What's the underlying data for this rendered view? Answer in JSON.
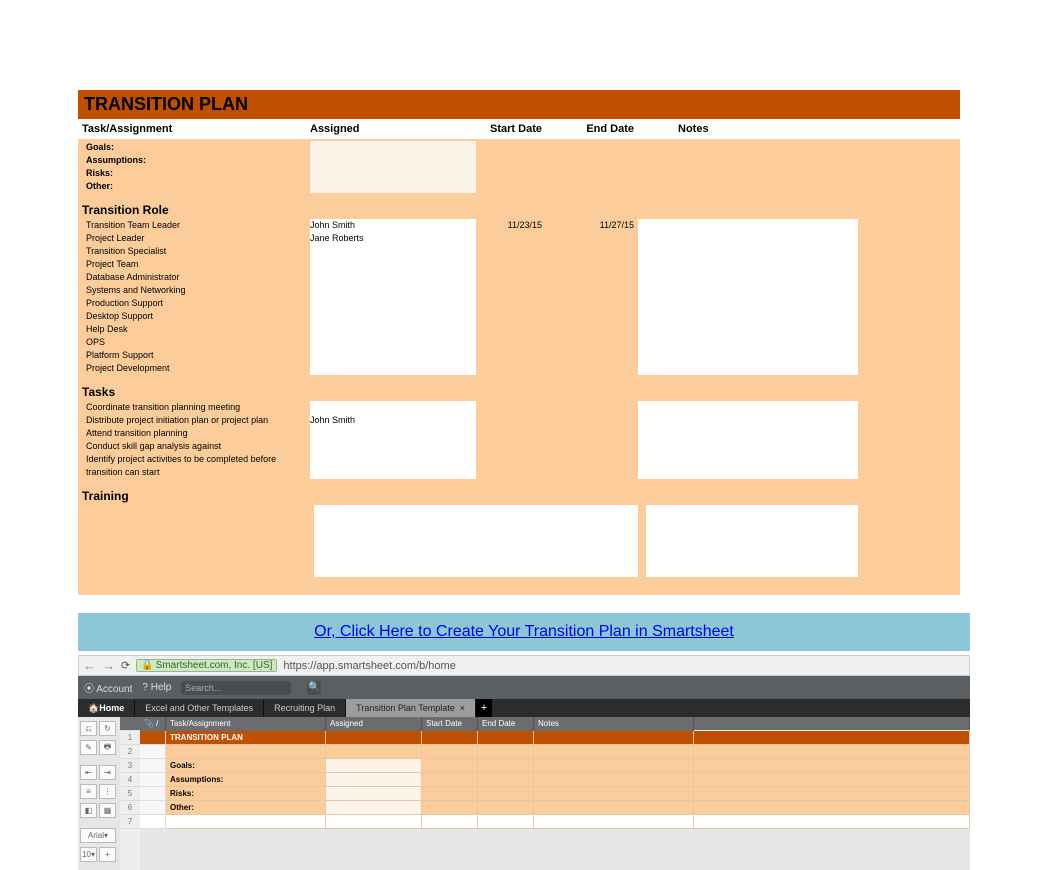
{
  "title": "TRANSITION PLAN",
  "columns": {
    "task": "Task/Assignment",
    "assigned": "Assigned",
    "start": "Start Date",
    "end": "End Date",
    "notes": "Notes"
  },
  "labels": {
    "goals": "Goals:",
    "assumptions": "Assumptions:",
    "risks": "Risks:",
    "other": "Other:",
    "transition_role": "Transition Role",
    "tasks": "Tasks",
    "training": "Training"
  },
  "roles": [
    {
      "name": "Transition Team Leader",
      "assigned": "John Smith",
      "start": "11/23/15",
      "end": "11/27/15"
    },
    {
      "name": "Project Leader",
      "assigned": "Jane Roberts",
      "start": "",
      "end": ""
    },
    {
      "name": "Transition Specialist",
      "assigned": "",
      "start": "",
      "end": ""
    },
    {
      "name": "Project Team",
      "assigned": "",
      "start": "",
      "end": ""
    },
    {
      "name": "Database Administrator",
      "assigned": "",
      "start": "",
      "end": ""
    },
    {
      "name": "Systems and Networking",
      "assigned": "",
      "start": "",
      "end": ""
    },
    {
      "name": "Production Support",
      "assigned": "",
      "start": "",
      "end": ""
    },
    {
      "name": "Desktop Support",
      "assigned": "",
      "start": "",
      "end": ""
    },
    {
      "name": "Help Desk",
      "assigned": "",
      "start": "",
      "end": ""
    },
    {
      "name": "OPS",
      "assigned": "",
      "start": "",
      "end": ""
    },
    {
      "name": "Platform Support",
      "assigned": "",
      "start": "",
      "end": ""
    },
    {
      "name": "Project Development",
      "assigned": "",
      "start": "",
      "end": ""
    }
  ],
  "tasks": [
    {
      "name": "Coordinate transition planning meeting",
      "assigned": ""
    },
    {
      "name": "Distribute project initiation plan or project plan",
      "assigned": "John Smith"
    },
    {
      "name": "Attend transition planning",
      "assigned": ""
    },
    {
      "name": "Conduct skill gap analysis against",
      "assigned": ""
    },
    {
      "name": "Identify project activities to be completed before transition can start",
      "assigned": ""
    }
  ],
  "cta": "Or, Click Here to Create Your Transition Plan in Smartsheet",
  "browser": {
    "cert": "Smartsheet.com, Inc. [US]",
    "url": "https://app.smartsheet.com/b/home"
  },
  "smartsheet": {
    "account": "Account",
    "help": "Help",
    "search_placeholder": "Search...",
    "tabs": {
      "home": "Home",
      "excel": "Excel and Other Templates",
      "recruiting": "Recruiting Plan",
      "transition": "Transition Plan Template"
    },
    "font": "Arial",
    "size": "10",
    "gridhead": {
      "task": "Task/Assignment",
      "assigned": "Assigned",
      "start": "Start Date",
      "end": "End Date",
      "notes": "Notes"
    },
    "gridrows": {
      "title": "TRANSITION PLAN",
      "goals": "Goals:",
      "assumptions": "Assumptions:",
      "risks": "Risks:",
      "other": "Other:"
    }
  }
}
